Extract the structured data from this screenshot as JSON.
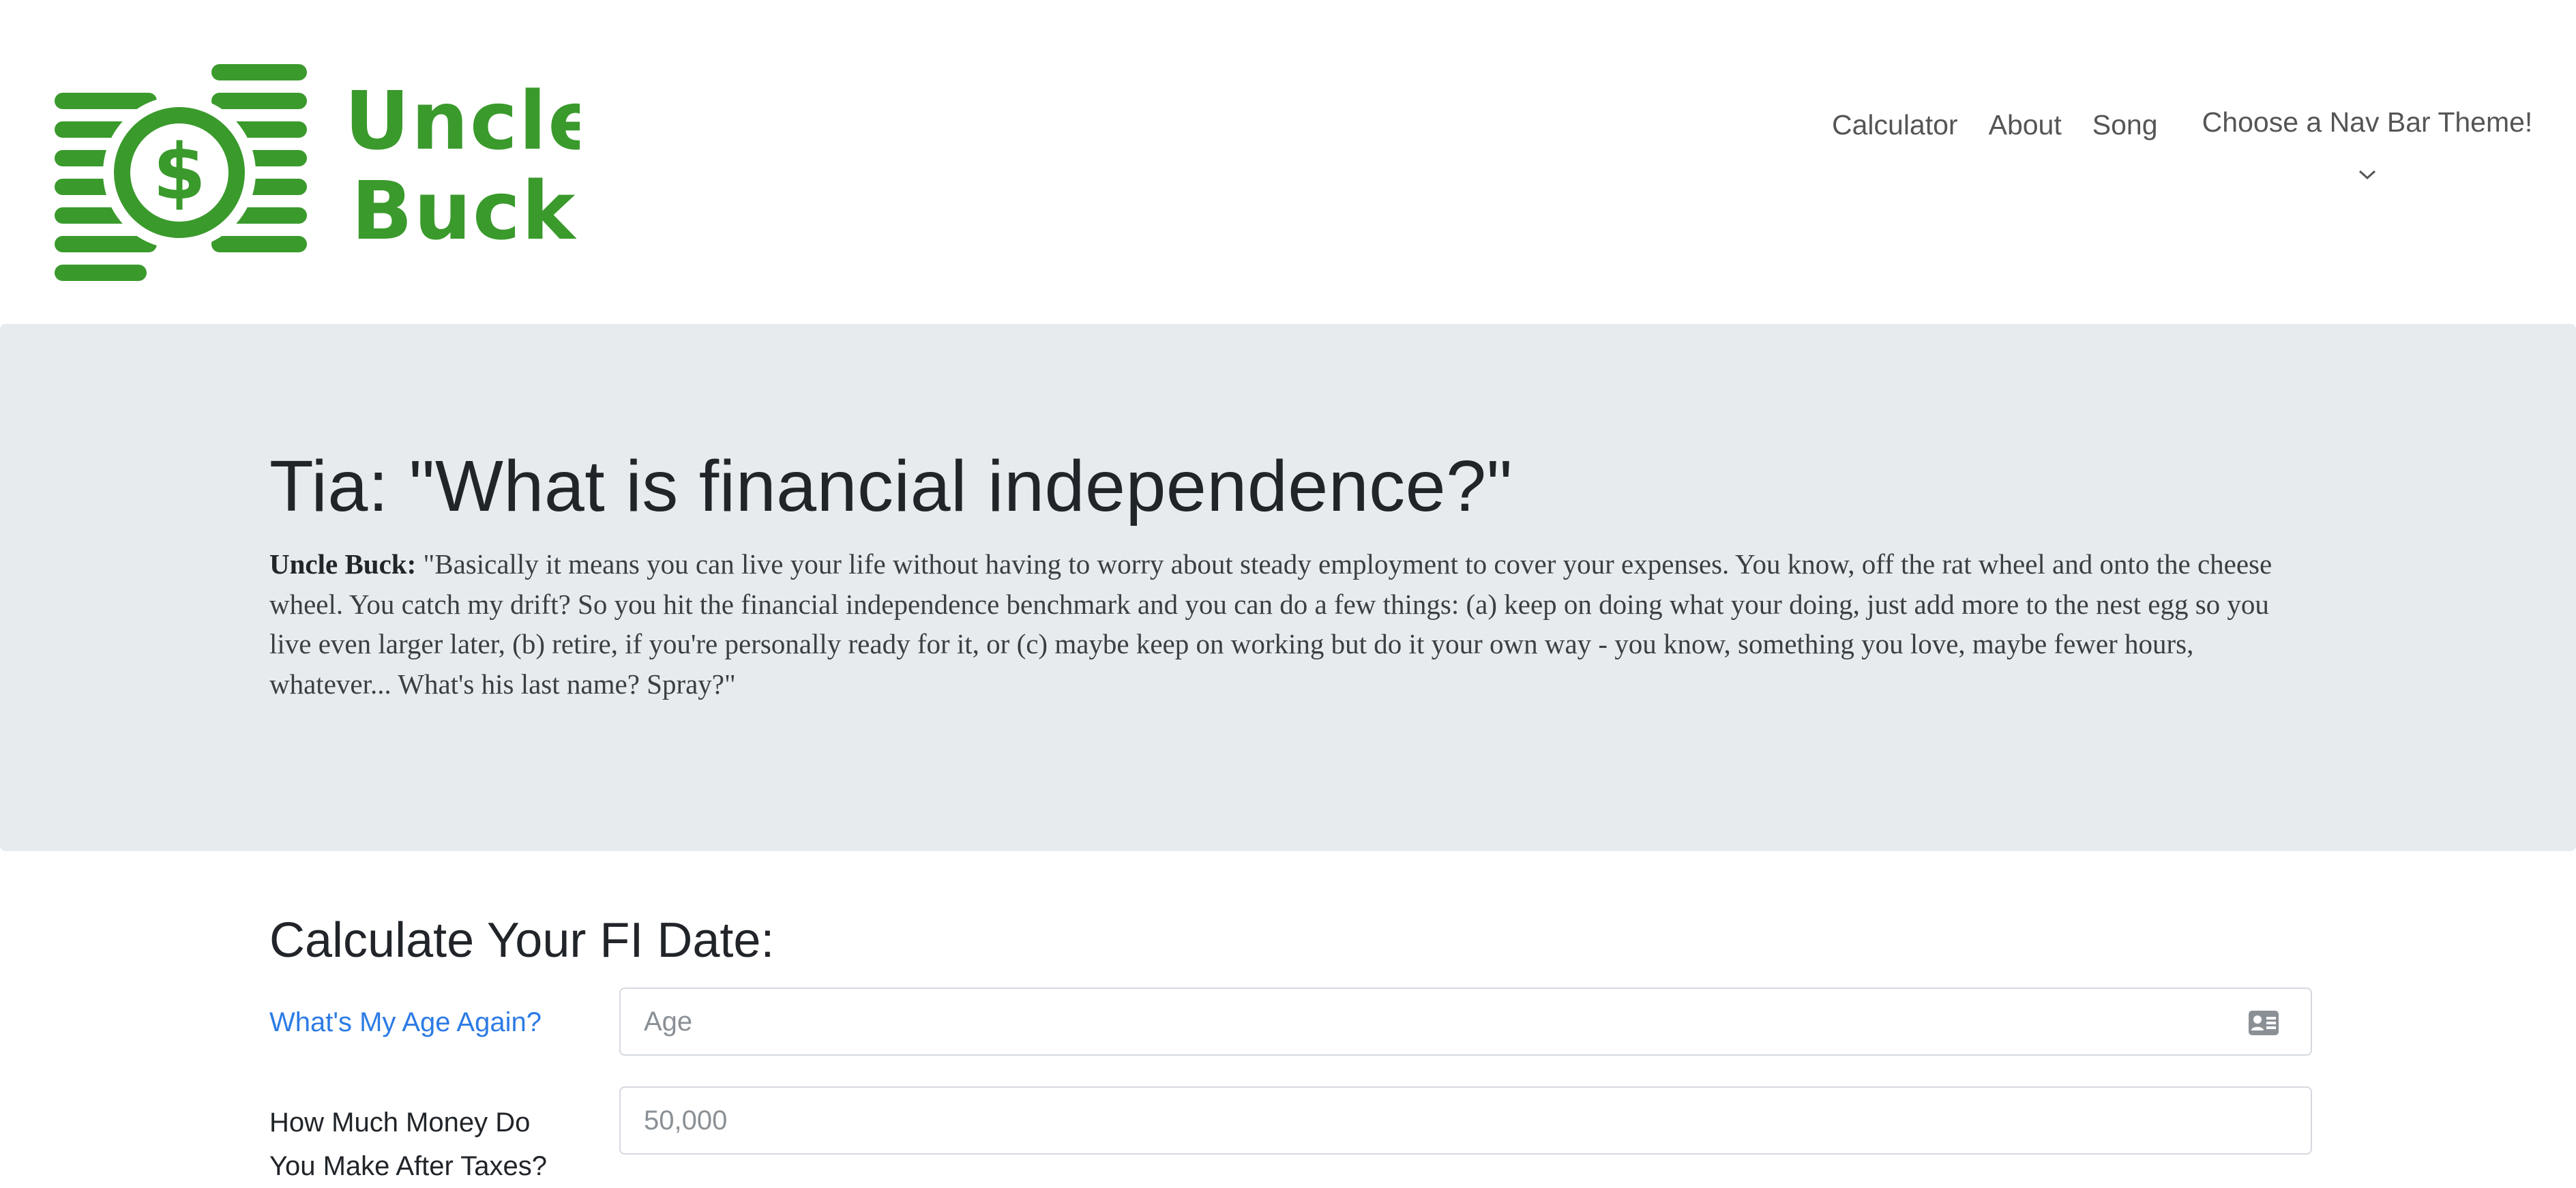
{
  "brand": {
    "name_line1": "Uncle",
    "name_line2": "Buck",
    "logo_symbol": "$",
    "logo_color": "#3a9a2c"
  },
  "nav": {
    "links": [
      "Calculator",
      "About",
      "Song"
    ],
    "theme_dropdown_label": "Choose a Nav Bar Theme!"
  },
  "hero": {
    "title": "Tia: \"What is financial independence?\"",
    "speaker": "Uncle Buck:",
    "quote": "\"Basically it means you can live your life without having to worry about steady employment to cover your expenses. You know, off the rat wheel and onto the cheese wheel. You catch my drift? So you hit the financial independence benchmark and you can do a few things: (a) keep on doing what your doing, just add more to the nest egg so you live even larger later, (b) retire, if you're personally ready for it, or (c) maybe keep on working but do it your own way - you know, something you love, maybe fewer hours, whatever... What's his last name? Spray?\""
  },
  "calculator": {
    "title": "Calculate Your FI Date:",
    "age_label": "What's My Age Again?",
    "age_placeholder": "Age",
    "age_icon": "id-card-icon",
    "income_label_line1": "How Much Money Do",
    "income_label_line2": "You Make After Taxes?",
    "income_placeholder": "50,000"
  },
  "colors": {
    "accent_link": "#2c7be5",
    "hero_background": "#e8ebee"
  }
}
